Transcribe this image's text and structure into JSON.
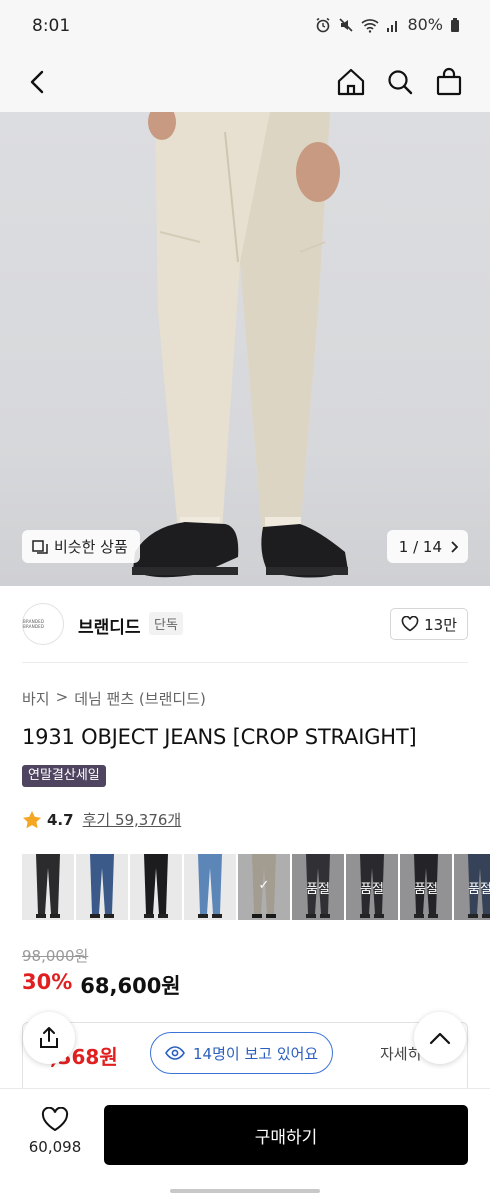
{
  "status_bar": {
    "time": "8:01",
    "battery": "80%"
  },
  "nav": {
    "icons": [
      "back-arrow-icon",
      "home-icon",
      "search-icon",
      "shopping-bag-icon"
    ]
  },
  "hero": {
    "similar_label": "비슷한 상품",
    "page_indicator": "1 / 14"
  },
  "brand": {
    "name": "브랜디드",
    "badge": "단독",
    "logo_text": "BRANDED BRANDED",
    "likes": "13만"
  },
  "breadcrumb": [
    "바지",
    "데님 팬츠 (브랜디드)"
  ],
  "product": {
    "title": "1931 OBJECT JEANS [CROP STRAIGHT]",
    "sale_tag": "연말결산세일",
    "rating": "4.7",
    "review_label": "후기 59,376개",
    "original_price": "98,000원",
    "discount": "30%",
    "price": "68,600원"
  },
  "thumbnails": [
    {
      "tone": "#2b2b2e",
      "state": ""
    },
    {
      "tone": "#3b5a8a",
      "state": ""
    },
    {
      "tone": "#1c1c1e",
      "state": ""
    },
    {
      "tone": "#5d86b8",
      "state": ""
    },
    {
      "tone": "#d9d2c0",
      "state": "selected",
      "mark": "✓"
    },
    {
      "tone": "#3a3a3d",
      "state": "soldout",
      "mark": "품절"
    },
    {
      "tone": "#2c2c30",
      "state": "soldout",
      "mark": "품절"
    },
    {
      "tone": "#222226",
      "state": "soldout",
      "mark": "품절"
    },
    {
      "tone": "#41587a",
      "state": "soldout",
      "mark": "품절"
    }
  ],
  "coupon": {
    "price": ",368원",
    "viewers": "14명이 보고 있어요",
    "detail": "자세히"
  },
  "bottom": {
    "wish_count": "60,098",
    "buy_label": "구매하기"
  },
  "colors": {
    "accent_red": "#e02020",
    "viewer_blue": "#2a5fbf",
    "sale_tag": "#4f4560"
  }
}
